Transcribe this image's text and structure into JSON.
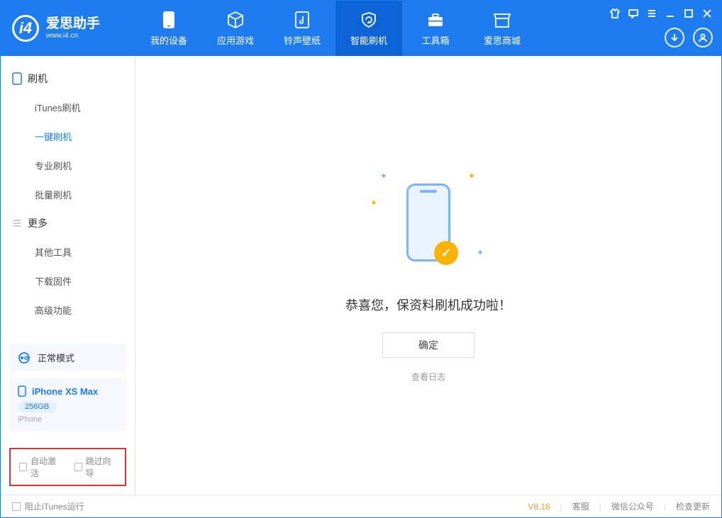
{
  "app": {
    "title": "爱思助手",
    "subtitle": "www.i4.cn"
  },
  "nav": {
    "tabs": [
      {
        "label": "我的设备"
      },
      {
        "label": "应用游戏"
      },
      {
        "label": "铃声壁纸"
      },
      {
        "label": "智能刷机"
      },
      {
        "label": "工具箱"
      },
      {
        "label": "爱思商城"
      }
    ],
    "active_index": 3
  },
  "sidebar": {
    "sections": [
      {
        "title": "刷机",
        "items": [
          "iTunes刷机",
          "一键刷机",
          "专业刷机",
          "批量刷机"
        ],
        "active_item": 1
      },
      {
        "title": "更多",
        "items": [
          "其他工具",
          "下载固件",
          "高级功能"
        ],
        "active_item": -1
      }
    ]
  },
  "device": {
    "mode_label": "正常模式",
    "name": "iPhone XS Max",
    "capacity": "256GB",
    "type": "iPhone"
  },
  "options": {
    "auto_activate": "自动激活",
    "skip_guide": "跳过向导"
  },
  "main": {
    "success_text": "恭喜您，保资料刷机成功啦！",
    "ok_button": "确定",
    "view_log": "查看日志"
  },
  "footer": {
    "block_itunes": "阻止iTunes运行",
    "version": "V8.16",
    "links": [
      "客服",
      "微信公众号",
      "检查更新"
    ]
  }
}
